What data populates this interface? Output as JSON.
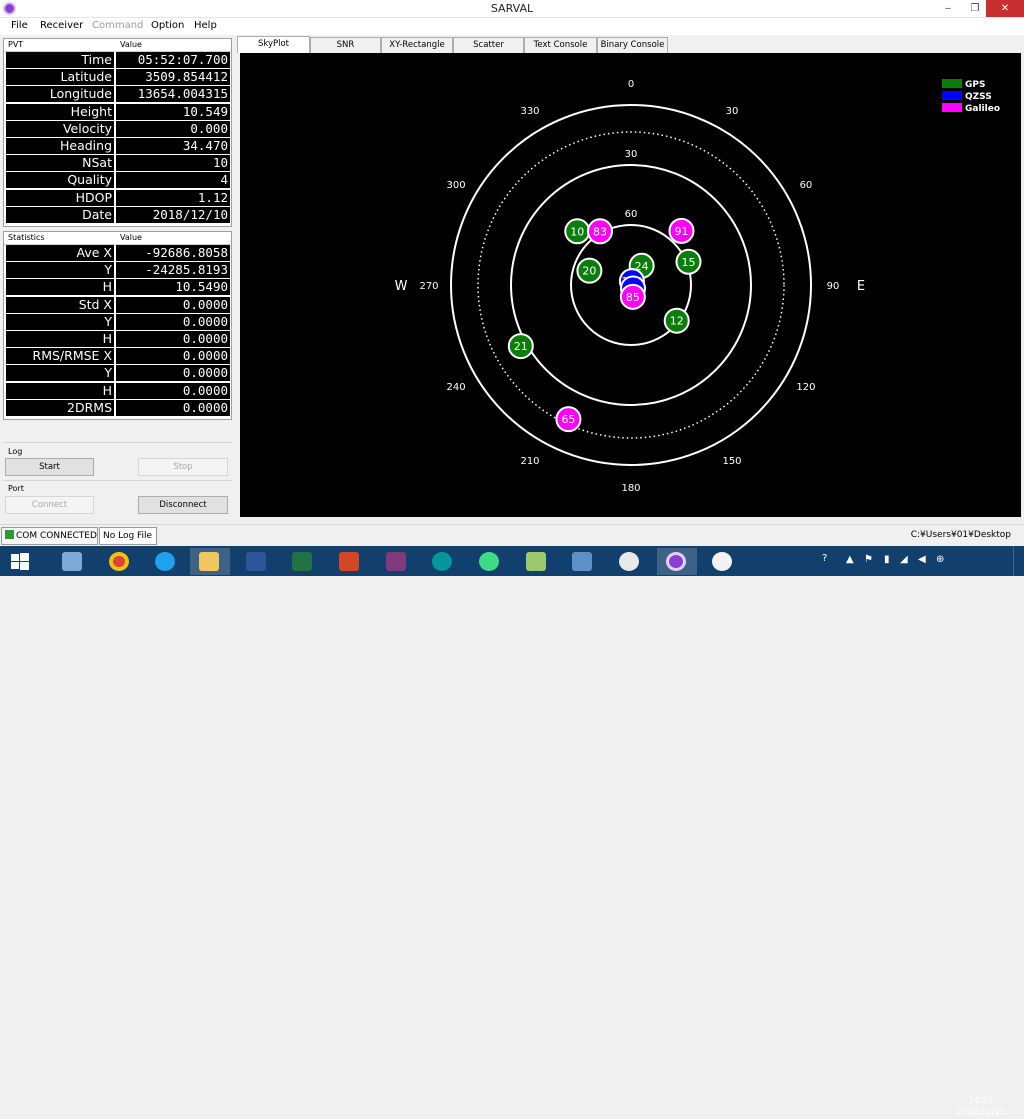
{
  "window": {
    "title": "SARVAL",
    "minimize": "‒",
    "restore": "❐",
    "close": "✕"
  },
  "menu": [
    "File",
    "Receiver",
    "Command",
    "Option",
    "Help"
  ],
  "pvt": {
    "col1": "PVT",
    "col2": "Value",
    "rows": [
      {
        "k": "Time",
        "v": "05:52:07.700"
      },
      {
        "k": "Latitude",
        "v": "3509.854412"
      },
      {
        "k": "Longitude",
        "v": "13654.004315"
      },
      {
        "k": "Height",
        "v": "10.549"
      },
      {
        "k": "Velocity",
        "v": "0.000"
      },
      {
        "k": "Heading",
        "v": "34.470"
      },
      {
        "k": "NSat",
        "v": "10"
      },
      {
        "k": "Quality",
        "v": "4"
      },
      {
        "k": "HDOP",
        "v": "1.12"
      },
      {
        "k": "Date",
        "v": "2018/12/10"
      }
    ]
  },
  "stats": {
    "col1": "Statistics",
    "col2": "Value",
    "rows": [
      {
        "k": "Ave X",
        "v": "-92686.8058"
      },
      {
        "k": "Y",
        "v": "-24285.8193"
      },
      {
        "k": "H",
        "v": "10.5490"
      },
      {
        "k": "Std X",
        "v": "0.0000"
      },
      {
        "k": "Y",
        "v": "0.0000"
      },
      {
        "k": "H",
        "v": "0.0000"
      },
      {
        "k": "RMS/RMSE X",
        "v": "0.0000"
      },
      {
        "k": "Y",
        "v": "0.0000"
      },
      {
        "k": "H",
        "v": "0.0000"
      },
      {
        "k": "2DRMS",
        "v": "0.0000"
      }
    ]
  },
  "log": {
    "label": "Log",
    "start": "Start",
    "stop": "Stop"
  },
  "port": {
    "label": "Port",
    "connect": "Connect",
    "disconnect": "Disconnect"
  },
  "tabs": [
    "SkyPlot",
    "SNR",
    "XY-Rectangle",
    "Scatter",
    "Text Console",
    "Binary Console"
  ],
  "skyplot": {
    "compass": {
      "north": "0",
      "east": "E",
      "west": "W"
    },
    "azimuth_labels": [
      "0",
      "30",
      "60",
      "90",
      "120",
      "150",
      "180",
      "210",
      "240",
      "270",
      "300",
      "330"
    ],
    "elevation_labels": [
      "30",
      "60"
    ],
    "legend": [
      {
        "name": "GPS",
        "color": "#0a7d0a"
      },
      {
        "name": "QZSS",
        "color": "#0000ff"
      },
      {
        "name": "Galileo",
        "color": "#ff00ff"
      }
    ],
    "satellites": [
      {
        "id": "10",
        "sys": "GPS",
        "az": 315,
        "el": 52
      },
      {
        "id": "83",
        "sys": "Galileo",
        "az": 330,
        "el": 59
      },
      {
        "id": "24",
        "sys": "GPS",
        "az": 29,
        "el": 79
      },
      {
        "id": "91",
        "sys": "Galileo",
        "az": 43,
        "el": 53
      },
      {
        "id": "15",
        "sys": "GPS",
        "az": 68,
        "el": 59
      },
      {
        "id": "20",
        "sys": "GPS",
        "az": 289,
        "el": 68
      },
      {
        "id": "194",
        "sys": "QZSS",
        "az": 13,
        "el": 88
      },
      {
        "id": "1",
        "sys": "QZSS",
        "az": 150,
        "el": 88
      },
      {
        "id": "85",
        "sys": "Galileo",
        "az": 171,
        "el": 84
      },
      {
        "id": "12",
        "sys": "GPS",
        "az": 128,
        "el": 61
      },
      {
        "id": "21",
        "sys": "GPS",
        "az": 241,
        "el": 27
      },
      {
        "id": "65",
        "sys": "Galileo",
        "az": 205,
        "el": 16
      }
    ]
  },
  "status": {
    "com": "COM CONNECTED",
    "log": "No Log File",
    "path": "C:¥Users¥01¥Desktop"
  },
  "taskbar": {
    "time": "14:52",
    "date": "2018/12/10"
  }
}
